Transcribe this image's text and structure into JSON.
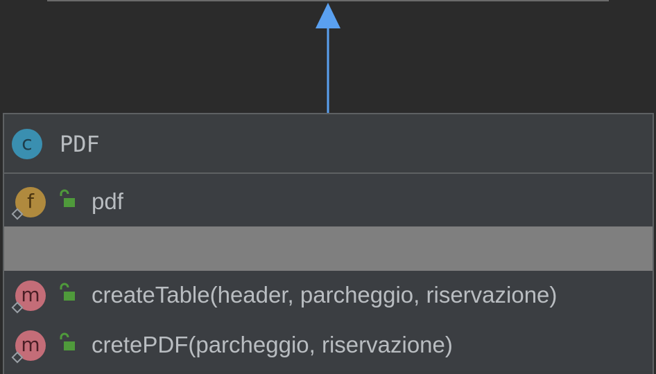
{
  "diagram": {
    "class": {
      "icon_letter": "c",
      "name": "PDF"
    },
    "fields": [
      {
        "icon_letter": "f",
        "visibility": "public-lock-icon",
        "text": "pdf"
      }
    ],
    "methods": [
      {
        "icon_letter": "m",
        "visibility": "public-lock-icon",
        "text": "createTable(header, parcheggio, riservazione)"
      },
      {
        "icon_letter": "m",
        "visibility": "public-lock-icon",
        "text": "cretePDF(parcheggio, riservazione)"
      }
    ]
  },
  "colors": {
    "background": "#2b2b2b",
    "arrow": "#5aa0f0",
    "class_icon": "#3a8fb0",
    "field_icon": "#b08a3e",
    "method_icon": "#c46d78",
    "lock": "#4f9a3b",
    "separator_band": "#7f7f7f",
    "text": "#b9bdc1"
  }
}
